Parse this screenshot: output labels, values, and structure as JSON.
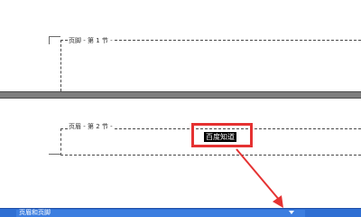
{
  "page1": {
    "footer_label": "页脚 - 第 1 节 -"
  },
  "page2": {
    "header_label": "页眉 - 第 2 节 -",
    "selected_text": "百度知道"
  },
  "toolbar": {
    "title": "页眉和页脚"
  },
  "colors": {
    "highlight": "#e53232",
    "toolbar": "#2f6fd3",
    "page_gap": "#7d7d7d"
  },
  "icons": {
    "annotation_arrow": "red-arrow-icon",
    "dropdown": "chevron-down-icon"
  }
}
